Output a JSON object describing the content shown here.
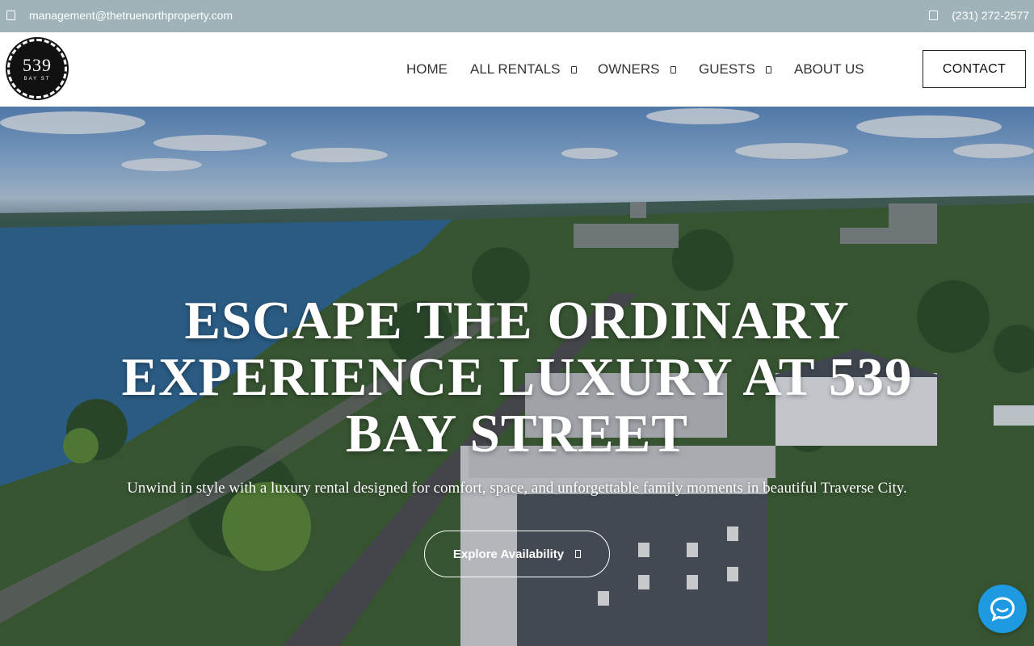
{
  "topbar": {
    "email": "management@thetruenorthproperty.com",
    "phone": "(231) 272-2577",
    "email_icon": "envelope-icon",
    "phone_icon": "phone-icon"
  },
  "logo": {
    "number": "539",
    "sub": "BAY ST"
  },
  "nav": {
    "items": [
      {
        "label": "HOME",
        "has_dropdown": false
      },
      {
        "label": "ALL RENTALS",
        "has_dropdown": true
      },
      {
        "label": "OWNERS",
        "has_dropdown": true
      },
      {
        "label": "GUESTS",
        "has_dropdown": true
      },
      {
        "label": "ABOUT US",
        "has_dropdown": false
      }
    ],
    "contact_label": "CONTACT"
  },
  "hero": {
    "headline_lines": [
      "ESCAPE THE ORDINARY",
      "EXPERIENCE LUXURY AT 539",
      "BAY STREET"
    ],
    "subline": "Unwind in style with a luxury rental designed for comfort, space, and unforgettable family moments in beautiful Traverse City.",
    "cta_label": "Explore Availability",
    "cta_icon": "arrow-right-icon"
  },
  "chat": {
    "icon": "chat-icon",
    "color": "#1e9ae3"
  },
  "colors": {
    "topbar": "#9fb3b9",
    "text_dark": "#333333",
    "white": "#ffffff"
  }
}
